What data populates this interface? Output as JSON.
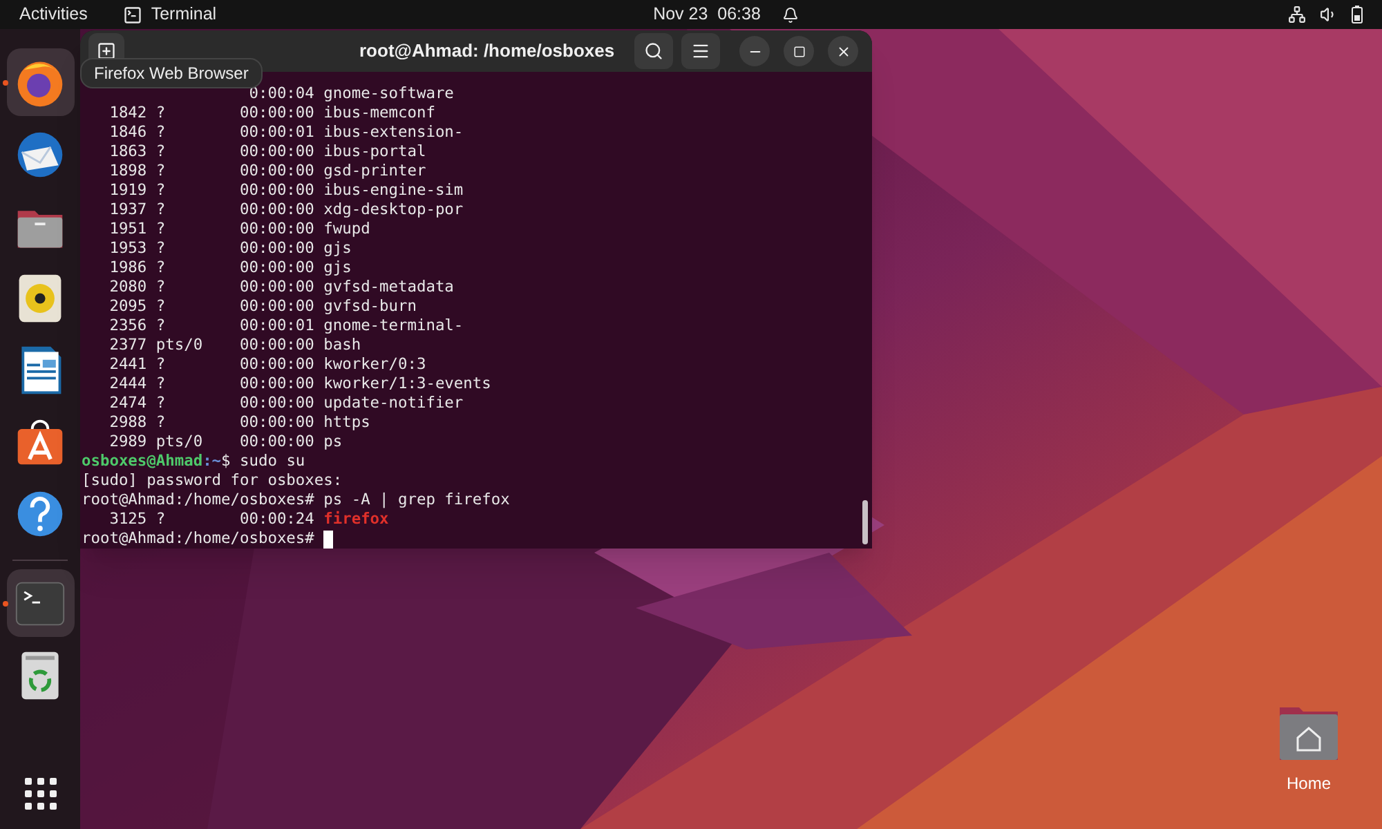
{
  "top_bar": {
    "activities": "Activities",
    "app": "Terminal",
    "clock": "Nov 23  06:38"
  },
  "dock": {
    "items": [
      {
        "kind": "firefox",
        "running": true,
        "highlighted": true
      },
      {
        "kind": "thunderbird",
        "running": false,
        "highlighted": false
      },
      {
        "kind": "files",
        "running": false,
        "highlighted": false
      },
      {
        "kind": "rhythmbox",
        "running": false,
        "highlighted": false
      },
      {
        "kind": "writer",
        "running": false,
        "highlighted": false
      },
      {
        "kind": "app-center",
        "running": false,
        "highlighted": false
      },
      {
        "kind": "help",
        "running": false,
        "highlighted": false
      },
      {
        "kind": "separator"
      },
      {
        "kind": "terminal",
        "running": true,
        "highlighted": true
      },
      {
        "kind": "trash",
        "running": false,
        "highlighted": false
      }
    ]
  },
  "tooltip": "Firefox Web Browser",
  "terminal": {
    "title": "root@Ahmad: /home/osboxes",
    "lines": [
      {
        "kind": "process",
        "time": "0:00:04",
        "cmd": "gnome-software",
        "match": false
      },
      {
        "kind": "process",
        "pid": "1842",
        "tty": "?",
        "time": "00:00:00",
        "cmd": "ibus-memconf",
        "match": false
      },
      {
        "kind": "process",
        "pid": "1846",
        "tty": "?",
        "time": "00:00:01",
        "cmd": "ibus-extension-",
        "match": false
      },
      {
        "kind": "process",
        "pid": "1863",
        "tty": "?",
        "time": "00:00:00",
        "cmd": "ibus-portal",
        "match": false
      },
      {
        "kind": "process",
        "pid": "1898",
        "tty": "?",
        "time": "00:00:00",
        "cmd": "gsd-printer",
        "match": false
      },
      {
        "kind": "process",
        "pid": "1919",
        "tty": "?",
        "time": "00:00:00",
        "cmd": "ibus-engine-sim",
        "match": false
      },
      {
        "kind": "process",
        "pid": "1937",
        "tty": "?",
        "time": "00:00:00",
        "cmd": "xdg-desktop-por",
        "match": false
      },
      {
        "kind": "process",
        "pid": "1951",
        "tty": "?",
        "time": "00:00:00",
        "cmd": "fwupd",
        "match": false
      },
      {
        "kind": "process",
        "pid": "1953",
        "tty": "?",
        "time": "00:00:00",
        "cmd": "gjs",
        "match": false
      },
      {
        "kind": "process",
        "pid": "1986",
        "tty": "?",
        "time": "00:00:00",
        "cmd": "gjs",
        "match": false
      },
      {
        "kind": "process",
        "pid": "2080",
        "tty": "?",
        "time": "00:00:00",
        "cmd": "gvfsd-metadata",
        "match": false
      },
      {
        "kind": "process",
        "pid": "2095",
        "tty": "?",
        "time": "00:00:00",
        "cmd": "gvfsd-burn",
        "match": false
      },
      {
        "kind": "process",
        "pid": "2356",
        "tty": "?",
        "time": "00:00:01",
        "cmd": "gnome-terminal-",
        "match": false
      },
      {
        "kind": "process",
        "pid": "2377",
        "tty": "pts/0",
        "time": "00:00:00",
        "cmd": "bash",
        "match": false
      },
      {
        "kind": "process",
        "pid": "2441",
        "tty": "?",
        "time": "00:00:00",
        "cmd": "kworker/0:3",
        "match": false
      },
      {
        "kind": "process",
        "pid": "2444",
        "tty": "?",
        "time": "00:00:00",
        "cmd": "kworker/1:3-events",
        "match": false
      },
      {
        "kind": "process",
        "pid": "2474",
        "tty": "?",
        "time": "00:00:00",
        "cmd": "update-notifier",
        "match": false
      },
      {
        "kind": "process",
        "pid": "2988",
        "tty": "?",
        "time": "00:00:00",
        "cmd": "https",
        "match": false
      },
      {
        "kind": "process",
        "pid": "2989",
        "tty": "pts/0",
        "time": "00:00:00",
        "cmd": "ps",
        "match": false
      },
      {
        "kind": "user_prompt",
        "user": "osboxes@Ahmad",
        "path": ":~",
        "rest": "$ sudo su"
      },
      {
        "kind": "output",
        "text": "[sudo] password for osboxes:"
      },
      {
        "kind": "root_prompt",
        "text": "root@Ahmad:/home/osboxes# ps -A | grep firefox",
        "cursor": false
      },
      {
        "kind": "process",
        "pid": "3125",
        "tty": "?",
        "time": "00:00:24",
        "cmd": "firefox",
        "match": true
      },
      {
        "kind": "root_prompt",
        "text": "root@Ahmad:/home/osboxes# ",
        "cursor": true
      }
    ]
  },
  "desktop_icons": [
    {
      "label": "Home"
    }
  ]
}
